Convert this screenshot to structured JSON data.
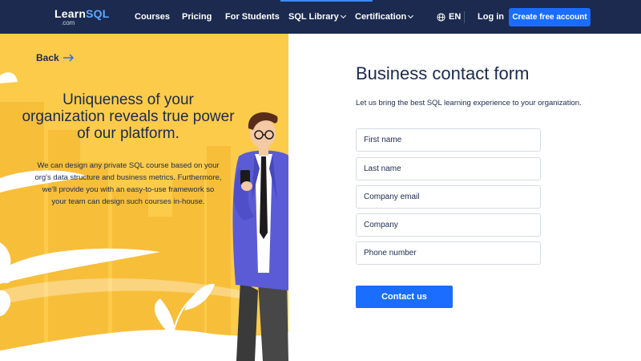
{
  "nav": {
    "logo_main_a": "Learn",
    "logo_main_b": "SQL",
    "logo_sub": "com",
    "items": [
      {
        "label": "Courses"
      },
      {
        "label": "Pricing"
      },
      {
        "label": "For Students"
      },
      {
        "label": "SQL Library"
      },
      {
        "label": "Certification"
      }
    ],
    "language": "EN",
    "login": "Log in",
    "cta": "Create free account"
  },
  "hero": {
    "back": "Back",
    "headline_lines": [
      "Uniqueness of your",
      "organization reveals true power",
      "of our platform."
    ],
    "description_lines": [
      "We can design any private SQL course based on your",
      "org's data structure and business metrics. Furthermore,",
      "we'll provide you with an easy-to-use framework so",
      "your team can design such courses in-house."
    ]
  },
  "form": {
    "title": "Business contact form",
    "subtitle": "Let us bring the best SQL learning experience to your organization.",
    "fields": [
      {
        "placeholder": "First name"
      },
      {
        "placeholder": "Last name"
      },
      {
        "placeholder": "Company email"
      },
      {
        "placeholder": "Company"
      },
      {
        "placeholder": "Phone number"
      }
    ],
    "submit": "Contact us"
  },
  "colors": {
    "nav_bg": "#1b2a4e",
    "accent_blue": "#1a6dff",
    "hero_yellow": "#fccb4a",
    "text_dark": "#1b2a4e"
  },
  "icons": [
    "globe-icon",
    "arrow-right-icon",
    "chevron-down-icon"
  ]
}
